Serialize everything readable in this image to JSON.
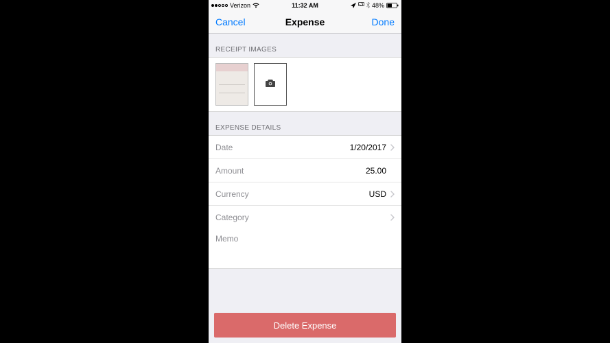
{
  "status": {
    "carrier": "Verizon",
    "time": "11:32 AM",
    "battery_pct": "48%"
  },
  "nav": {
    "cancel": "Cancel",
    "title": "Expense",
    "done": "Done"
  },
  "sections": {
    "receipt_images": "RECEIPT IMAGES",
    "expense_details": "EXPENSE DETAILS"
  },
  "details": {
    "date_label": "Date",
    "date_value": "1/20/2017",
    "amount_label": "Amount",
    "amount_value": "25.00",
    "currency_label": "Currency",
    "currency_value": "USD",
    "category_label": "Category",
    "category_value": "",
    "memo_label": "Memo",
    "memo_value": ""
  },
  "delete_label": "Delete Expense"
}
